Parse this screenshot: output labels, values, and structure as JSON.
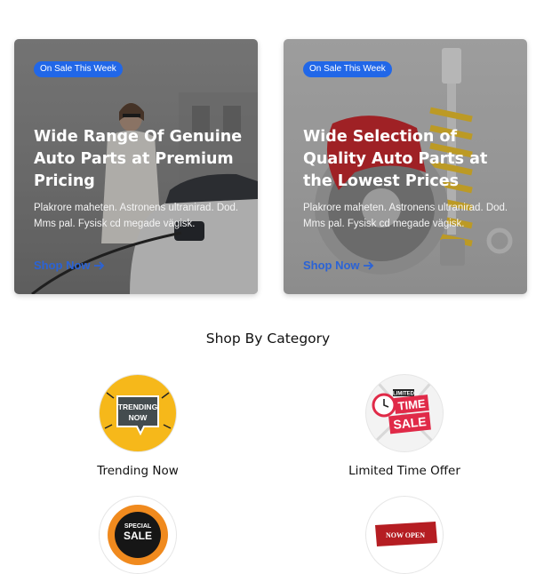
{
  "cards": [
    {
      "badge": "On Sale This Week",
      "title": "Wide Range Of Genuine Auto Parts at Premium Pricing",
      "text": "Plakrore maheten. Astronens ultranirad. Dod. Mms pal. Fysisk cd megade vägisk.",
      "link": "Shop Now"
    },
    {
      "badge": "On Sale This Week",
      "title": "Wide Selection of Quality Auto Parts at the Lowest Prices",
      "text": "Plakrore maheten. Astronens ultranirad. Dod. Mms pal. Fysisk cd megade vägisk.",
      "link": "Shop Now"
    }
  ],
  "section": {
    "title": "Shop By Category"
  },
  "categories": [
    {
      "label": "Trending Now",
      "logo_text": [
        "TRENDING",
        "NOW"
      ]
    },
    {
      "label": "Limited Time Offer",
      "logo_text": [
        "LIMITED",
        "TIME",
        "SALE"
      ]
    },
    {
      "label": "",
      "logo_text": [
        "SPECIAL",
        "SALE"
      ]
    },
    {
      "label": "",
      "logo_text": [
        "NOW OPEN"
      ]
    }
  ],
  "colors": {
    "accent": "#2167e8",
    "link": "#2b63d6"
  },
  "icons": {
    "link_arrow": "arrow-right-icon"
  }
}
